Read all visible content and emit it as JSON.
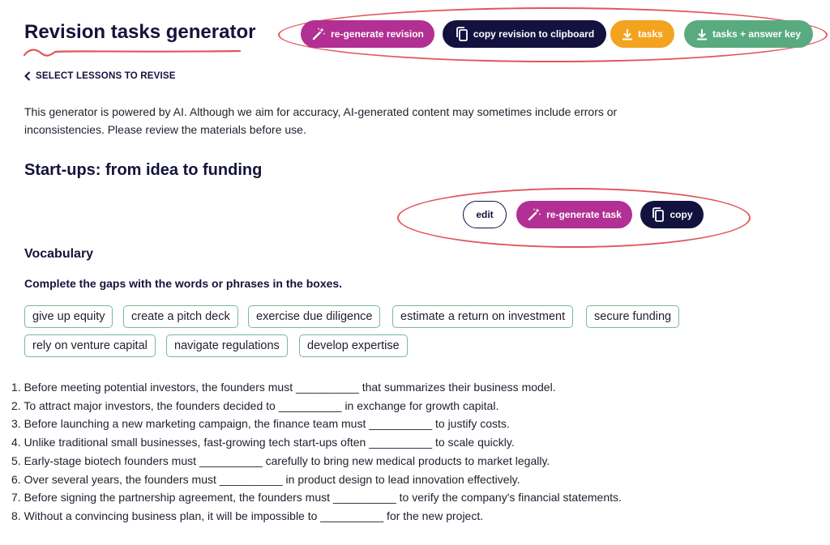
{
  "header": {
    "title": "Revision tasks generator",
    "buttons": {
      "regenerate_revision": "re-generate revision",
      "copy_revision": "copy revision to clipboard",
      "tasks": "tasks",
      "tasks_answer_key": "tasks + answer key"
    }
  },
  "nav": {
    "back_label": "SELECT LESSONS TO REVISE"
  },
  "disclaimer": "This generator is powered by AI. Although we aim for accuracy, AI-generated content may sometimes include errors or inconsistencies. Please review the materials before use.",
  "lesson": {
    "title": "Start-ups: from idea to funding",
    "task_buttons": {
      "edit": "edit",
      "regenerate_task": "re-generate task",
      "copy": "copy"
    }
  },
  "vocabulary": {
    "heading": "Vocabulary",
    "instruction": "Complete the gaps with the words or phrases in the boxes.",
    "word_bank": [
      "give up equity",
      "create a pitch deck",
      "exercise due diligence",
      "estimate a return on investment",
      "secure funding",
      "rely on venture capital",
      "navigate regulations",
      "develop expertise"
    ],
    "questions": [
      "1. Before meeting potential investors, the founders must __________ that summarizes their business model.",
      "2. To attract major investors, the founders decided to __________ in exchange for growth capital.",
      "3. Before launching a new marketing campaign, the finance team must __________ to justify costs.",
      "4. Unlike traditional small businesses, fast-growing tech start-ups often __________ to scale quickly.",
      "5. Early-stage biotech founders must __________ carefully to bring new medical products to market legally.",
      "6. Over several years, the founders must __________ in product design to lead innovation effectively.",
      "7. Before signing the partnership agreement, the founders must __________ to verify the company's financial statements.",
      "8. Without a convincing business plan, it will be impossible to __________ for the new project."
    ]
  },
  "colors": {
    "magenta": "#b22f93",
    "navy": "#13123f",
    "orange": "#f3a31e",
    "green": "#5aaa80",
    "annotation_red": "#e2555b"
  },
  "icons": {
    "regenerate": "magic-wand-icon",
    "copy": "copy-icon",
    "download": "download-icon",
    "back": "chevron-left-icon"
  }
}
